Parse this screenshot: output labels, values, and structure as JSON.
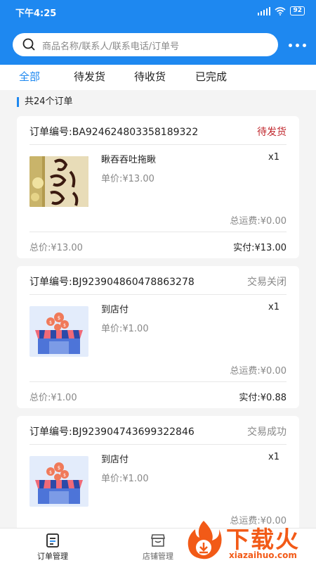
{
  "status_bar": {
    "time": "下午4:25",
    "battery": "92"
  },
  "search": {
    "placeholder": "商品名称/联系人/联系电话/订单号"
  },
  "tabs": [
    {
      "label": "全部",
      "active": true
    },
    {
      "label": "待发货",
      "active": false
    },
    {
      "label": "待收货",
      "active": false
    },
    {
      "label": "已完成",
      "active": false
    }
  ],
  "summary": {
    "order_count_text": "共24个订单"
  },
  "colors": {
    "accent": "#1e88f0",
    "pending_red": "#c0272d",
    "muted": "#888888",
    "watermark_orange": "#f25a17"
  },
  "orders": [
    {
      "order_no": "订单编号:BA924624803358189322",
      "status": "待发货",
      "status_color": "#c0272d",
      "product_name": "瞅吞吞吐拖瞅",
      "quantity": "x1",
      "unit_price": "单价:¥13.00",
      "shipping": "总运费:¥0.00",
      "total": "总价:¥13.00",
      "paid": "实付:¥13.00",
      "thumb_icon": "product-photo"
    },
    {
      "order_no": "订单编号:BJ923904860478863278",
      "status": "交易关闭",
      "status_color": "#888888",
      "product_name": "到店付",
      "quantity": "x1",
      "unit_price": "单价:¥1.00",
      "shipping": "总运费:¥0.00",
      "total": "总价:¥1.00",
      "paid": "实付:¥0.88",
      "thumb_icon": "store-coins-icon"
    },
    {
      "order_no": "订单编号:BJ923904743699322846",
      "status": "交易成功",
      "status_color": "#888888",
      "product_name": "到店付",
      "quantity": "x1",
      "unit_price": "单价:¥1.00",
      "shipping": "总运费:¥0.00",
      "thumb_icon": "store-coins-icon"
    }
  ],
  "bottom_nav": [
    {
      "label": "订单管理",
      "icon": "order-list-icon",
      "active": true
    },
    {
      "label": "店铺管理",
      "icon": "store-icon",
      "active": false
    }
  ],
  "watermark": {
    "title": "下载火",
    "url": "xiazaihuo.com"
  }
}
